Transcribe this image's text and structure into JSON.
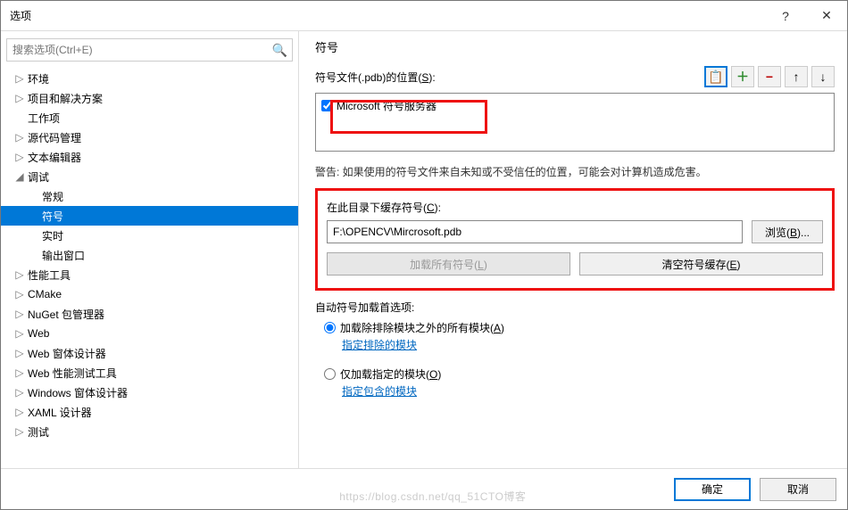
{
  "titlebar": {
    "title": "选项"
  },
  "search": {
    "placeholder": "搜索选项(Ctrl+E)"
  },
  "tree": [
    {
      "label": "环境",
      "expandable": true,
      "expanded": false,
      "depth": 0
    },
    {
      "label": "项目和解决方案",
      "expandable": true,
      "expanded": false,
      "depth": 0
    },
    {
      "label": "工作项",
      "expandable": false,
      "depth": 0
    },
    {
      "label": "源代码管理",
      "expandable": true,
      "expanded": false,
      "depth": 0
    },
    {
      "label": "文本编辑器",
      "expandable": true,
      "expanded": false,
      "depth": 0
    },
    {
      "label": "调试",
      "expandable": true,
      "expanded": true,
      "depth": 0
    },
    {
      "label": "常规",
      "depth": 1
    },
    {
      "label": "符号",
      "depth": 1,
      "selected": true
    },
    {
      "label": "实时",
      "depth": 1
    },
    {
      "label": "输出窗口",
      "depth": 1
    },
    {
      "label": "性能工具",
      "expandable": true,
      "expanded": false,
      "depth": 0
    },
    {
      "label": "CMake",
      "expandable": true,
      "expanded": false,
      "depth": 0
    },
    {
      "label": "NuGet 包管理器",
      "expandable": true,
      "expanded": false,
      "depth": 0
    },
    {
      "label": "Web",
      "expandable": true,
      "expanded": false,
      "depth": 0
    },
    {
      "label": "Web 窗体设计器",
      "expandable": true,
      "expanded": false,
      "depth": 0
    },
    {
      "label": "Web 性能测试工具",
      "expandable": true,
      "expanded": false,
      "depth": 0
    },
    {
      "label": "Windows 窗体设计器",
      "expandable": true,
      "expanded": false,
      "depth": 0
    },
    {
      "label": "XAML 设计器",
      "expandable": true,
      "expanded": false,
      "depth": 0
    },
    {
      "label": "测试",
      "expandable": true,
      "expanded": false,
      "depth": 0
    }
  ],
  "main": {
    "heading": "符号",
    "pdb_label_pre": "符号文件(.pdb)的位置(",
    "pdb_label_key": "S",
    "pdb_label_post": "):",
    "checkbox_ms": "Microsoft 符号服务器",
    "warning": "警告: 如果使用的符号文件来自未知或不受信任的位置，可能会对计算机造成危害。",
    "cache_label_pre": "在此目录下缓存符号(",
    "cache_label_key": "C",
    "cache_label_post": "):",
    "cache_value": "F:\\OPENCV\\Mircrosoft.pdb",
    "browse_pre": "浏览(",
    "browse_key": "B",
    "browse_post": ")...",
    "load_all_pre": "加载所有符号(",
    "load_all_key": "L",
    "load_all_post": ")",
    "clear_pre": "清空符号缓存(",
    "clear_key": "E",
    "clear_post": ")",
    "auto_head": "自动符号加载首选项:",
    "radio1_pre": "加载除排除模块之外的所有模块(",
    "radio1_key": "A",
    "radio1_post": ")",
    "link1": "指定排除的模块",
    "radio2_pre": "仅加载指定的模块(",
    "radio2_key": "O",
    "radio2_post": ")",
    "link2": "指定包含的模块"
  },
  "footer": {
    "ok": "确定",
    "cancel": "取消",
    "watermark": "https://blog.csdn.net/qq_51CTO博客"
  }
}
